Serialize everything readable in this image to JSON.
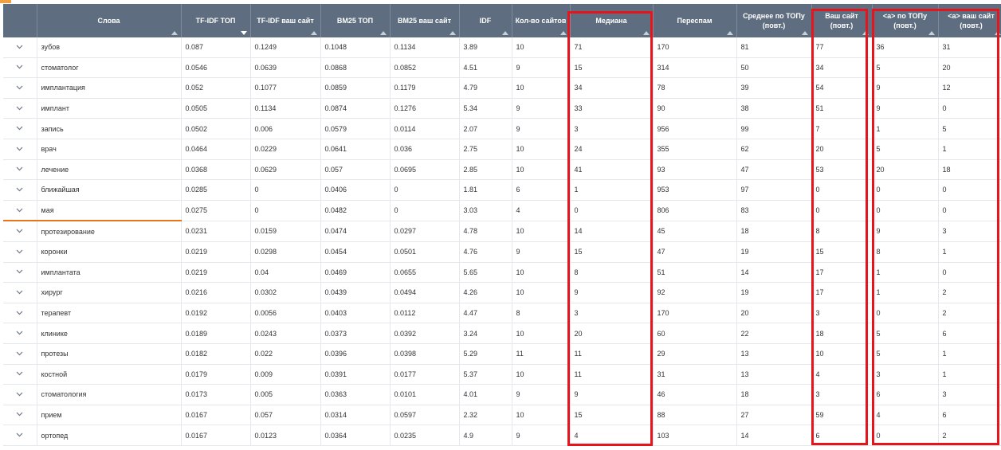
{
  "table": {
    "columns": [
      "Слова",
      "TF-IDF ТОП",
      "TF-IDF ваш сайт",
      "BM25 ТОП",
      "BM25 ваш сайт",
      "IDF",
      "Кол-во сайтов",
      "Медиана",
      "Переспам",
      "Среднее по ТОПу (повт.)",
      "Ваш сайт (повт.)",
      "<a> по ТОПу (повт.)",
      "<a> ваш сайт (повт.)"
    ],
    "expand_icon": "chevron-down-icon",
    "rows": [
      [
        "зубов",
        "0.087",
        "0.1249",
        "0.1048",
        "0.1134",
        "3.89",
        "10",
        "71",
        "170",
        "81",
        "77",
        "36",
        "31"
      ],
      [
        "стоматолог",
        "0.0546",
        "0.0639",
        "0.0868",
        "0.0852",
        "4.51",
        "9",
        "15",
        "314",
        "50",
        "34",
        "5",
        "20"
      ],
      [
        "имплантация",
        "0.052",
        "0.1077",
        "0.0859",
        "0.1179",
        "4.79",
        "10",
        "34",
        "78",
        "39",
        "54",
        "9",
        "12"
      ],
      [
        "имплант",
        "0.0505",
        "0.1134",
        "0.0874",
        "0.1276",
        "5.34",
        "9",
        "33",
        "90",
        "38",
        "51",
        "9",
        "0"
      ],
      [
        "запись",
        "0.0502",
        "0.006",
        "0.0579",
        "0.0114",
        "2.07",
        "9",
        "3",
        "956",
        "99",
        "7",
        "1",
        "5"
      ],
      [
        "врач",
        "0.0464",
        "0.0229",
        "0.0641",
        "0.036",
        "2.75",
        "10",
        "24",
        "355",
        "62",
        "20",
        "5",
        "1"
      ],
      [
        "лечение",
        "0.0368",
        "0.0629",
        "0.057",
        "0.0695",
        "2.85",
        "10",
        "41",
        "93",
        "47",
        "53",
        "20",
        "18"
      ],
      [
        "ближайшая",
        "0.0285",
        "0",
        "0.0406",
        "0",
        "1.81",
        "6",
        "1",
        "953",
        "97",
        "0",
        "0",
        "0"
      ],
      [
        "мая",
        "0.0275",
        "0",
        "0.0482",
        "0",
        "3.03",
        "4",
        "0",
        "806",
        "83",
        "0",
        "0",
        "0"
      ],
      [
        "протезирование",
        "0.0231",
        "0.0159",
        "0.0474",
        "0.0297",
        "4.78",
        "10",
        "14",
        "45",
        "18",
        "8",
        "9",
        "3"
      ],
      [
        "коронки",
        "0.0219",
        "0.0298",
        "0.0454",
        "0.0501",
        "4.76",
        "9",
        "15",
        "47",
        "19",
        "15",
        "8",
        "1"
      ],
      [
        "имплантата",
        "0.0219",
        "0.04",
        "0.0469",
        "0.0655",
        "5.65",
        "10",
        "8",
        "51",
        "14",
        "17",
        "1",
        "0"
      ],
      [
        "хирург",
        "0.0216",
        "0.0302",
        "0.0439",
        "0.0494",
        "4.26",
        "10",
        "9",
        "92",
        "19",
        "17",
        "1",
        "2"
      ],
      [
        "терапевт",
        "0.0192",
        "0.0056",
        "0.0403",
        "0.0112",
        "4.47",
        "8",
        "3",
        "170",
        "20",
        "3",
        "0",
        "2"
      ],
      [
        "клинике",
        "0.0189",
        "0.0243",
        "0.0373",
        "0.0392",
        "3.24",
        "10",
        "20",
        "60",
        "22",
        "18",
        "5",
        "6"
      ],
      [
        "протезы",
        "0.0182",
        "0.022",
        "0.0396",
        "0.0398",
        "5.29",
        "11",
        "11",
        "29",
        "13",
        "10",
        "5",
        "1"
      ],
      [
        "костной",
        "0.0179",
        "0.009",
        "0.0391",
        "0.0177",
        "5.37",
        "10",
        "11",
        "31",
        "13",
        "4",
        "3",
        "1"
      ],
      [
        "стоматология",
        "0.0173",
        "0.005",
        "0.0363",
        "0.0101",
        "4.01",
        "9",
        "9",
        "46",
        "18",
        "3",
        "6",
        "3"
      ],
      [
        "прием",
        "0.0167",
        "0.057",
        "0.0314",
        "0.0597",
        "2.32",
        "10",
        "15",
        "88",
        "27",
        "59",
        "4",
        "6"
      ],
      [
        "ортопед",
        "0.0167",
        "0.0123",
        "0.0364",
        "0.0235",
        "4.9",
        "9",
        "4",
        "103",
        "14",
        "6",
        "0",
        "2"
      ]
    ]
  },
  "colors": {
    "header_bg": "#5e6d7f",
    "highlight_box": "#e8141c",
    "active_row_underline": "#e8731d"
  }
}
